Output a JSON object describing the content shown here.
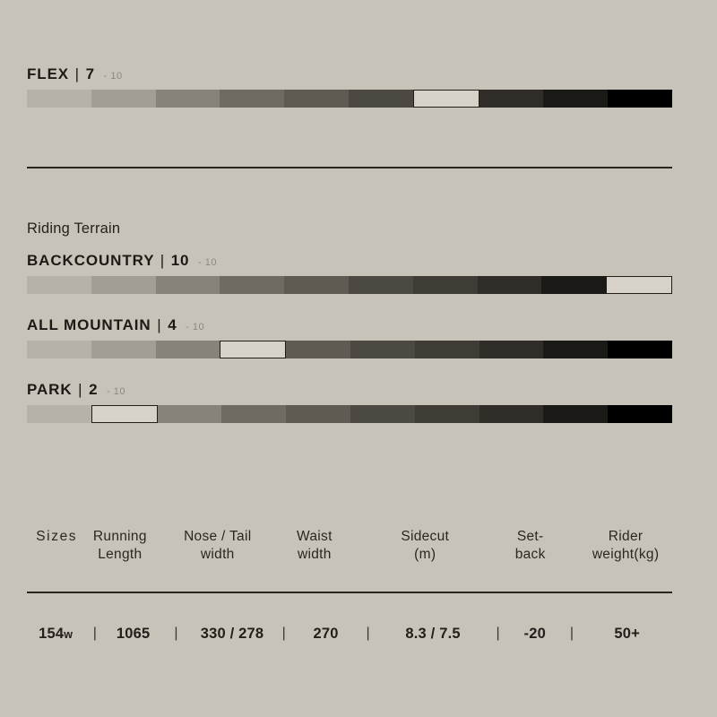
{
  "theme": {
    "background": "#c8c3b8",
    "text_dark": "#1d1a16",
    "muted": "#8d887e",
    "rule": "#2a2621",
    "active_fill": "#d6d2c7",
    "scale_colors": [
      "#b6b2a8",
      "#a39e94",
      "#878379",
      "#6f6b62",
      "#5f5b53",
      "#4c4942",
      "#3f3c36",
      "#302d29",
      "#1b1916",
      "#000000"
    ]
  },
  "flex": {
    "label": "FLEX",
    "separator": "|",
    "value": "7",
    "out_of": "- 10",
    "scale_max": 10,
    "active_index": 7
  },
  "terrain": {
    "caption": "Riding Terrain",
    "items": [
      {
        "label": "BACKCOUNTRY",
        "separator": "|",
        "value": "10",
        "out_of": "- 10",
        "scale_max": 10,
        "active_index": 10
      },
      {
        "label": "ALL MOUNTAIN",
        "separator": "|",
        "value": "4",
        "out_of": "- 10",
        "scale_max": 10,
        "active_index": 4
      },
      {
        "label": "PARK",
        "separator": "|",
        "value": "2",
        "out_of": "- 10",
        "scale_max": 10,
        "active_index": 2
      }
    ]
  },
  "spec_table": {
    "headers": {
      "sizes": "Sizes",
      "running_length": "Running\nLength",
      "nose_tail_width": "Nose / Tail\nwidth",
      "waist_width": "Waist\nwidth",
      "sidecut": "Sidecut\n(m)",
      "setback": "Set-\nback",
      "rider_weight": "Rider\nweight(kg)"
    },
    "separator": "|",
    "rows": [
      {
        "size": "154",
        "size_suffix": "w",
        "running_length": "1065",
        "nose_tail_width": "330 / 278",
        "waist_width": "270",
        "sidecut": "8.3 / 7.5",
        "setback": "-20",
        "rider_weight": "50+"
      }
    ]
  }
}
